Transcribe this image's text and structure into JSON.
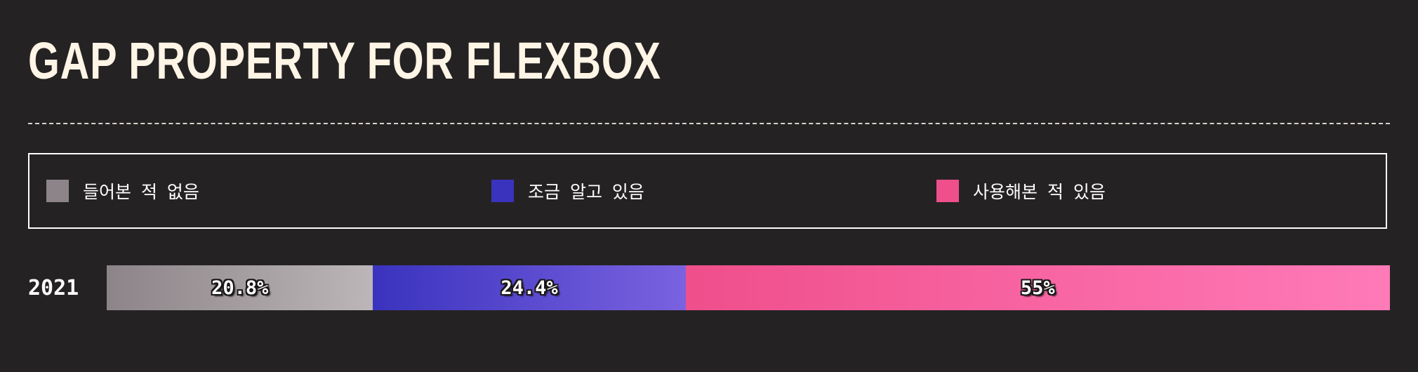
{
  "title": "GAP PROPERTY FOR FLEXBOX",
  "chart_data": {
    "type": "bar",
    "stacked": true,
    "orientation": "horizontal",
    "title": "GAP PROPERTY FOR FLEXBOX",
    "categories": [
      "2021"
    ],
    "xlim": [
      0,
      100
    ],
    "grid": false,
    "legend_position": "top",
    "series": [
      {
        "name": "들어본 적 없음",
        "values": [
          20.8
        ],
        "value_labels": [
          "20.8%"
        ],
        "color": "#8c8488",
        "color_end": "#bcb6b8"
      },
      {
        "name": "조금 알고 있음",
        "values": [
          24.4
        ],
        "value_labels": [
          "24.4%"
        ],
        "color": "#3a33be",
        "color_end": "#7a62e0"
      },
      {
        "name": "사용해본 적 있음",
        "values": [
          55
        ],
        "value_labels": [
          "55%"
        ],
        "color": "#ef4f8b",
        "color_end": "#ff7ab8"
      }
    ]
  }
}
